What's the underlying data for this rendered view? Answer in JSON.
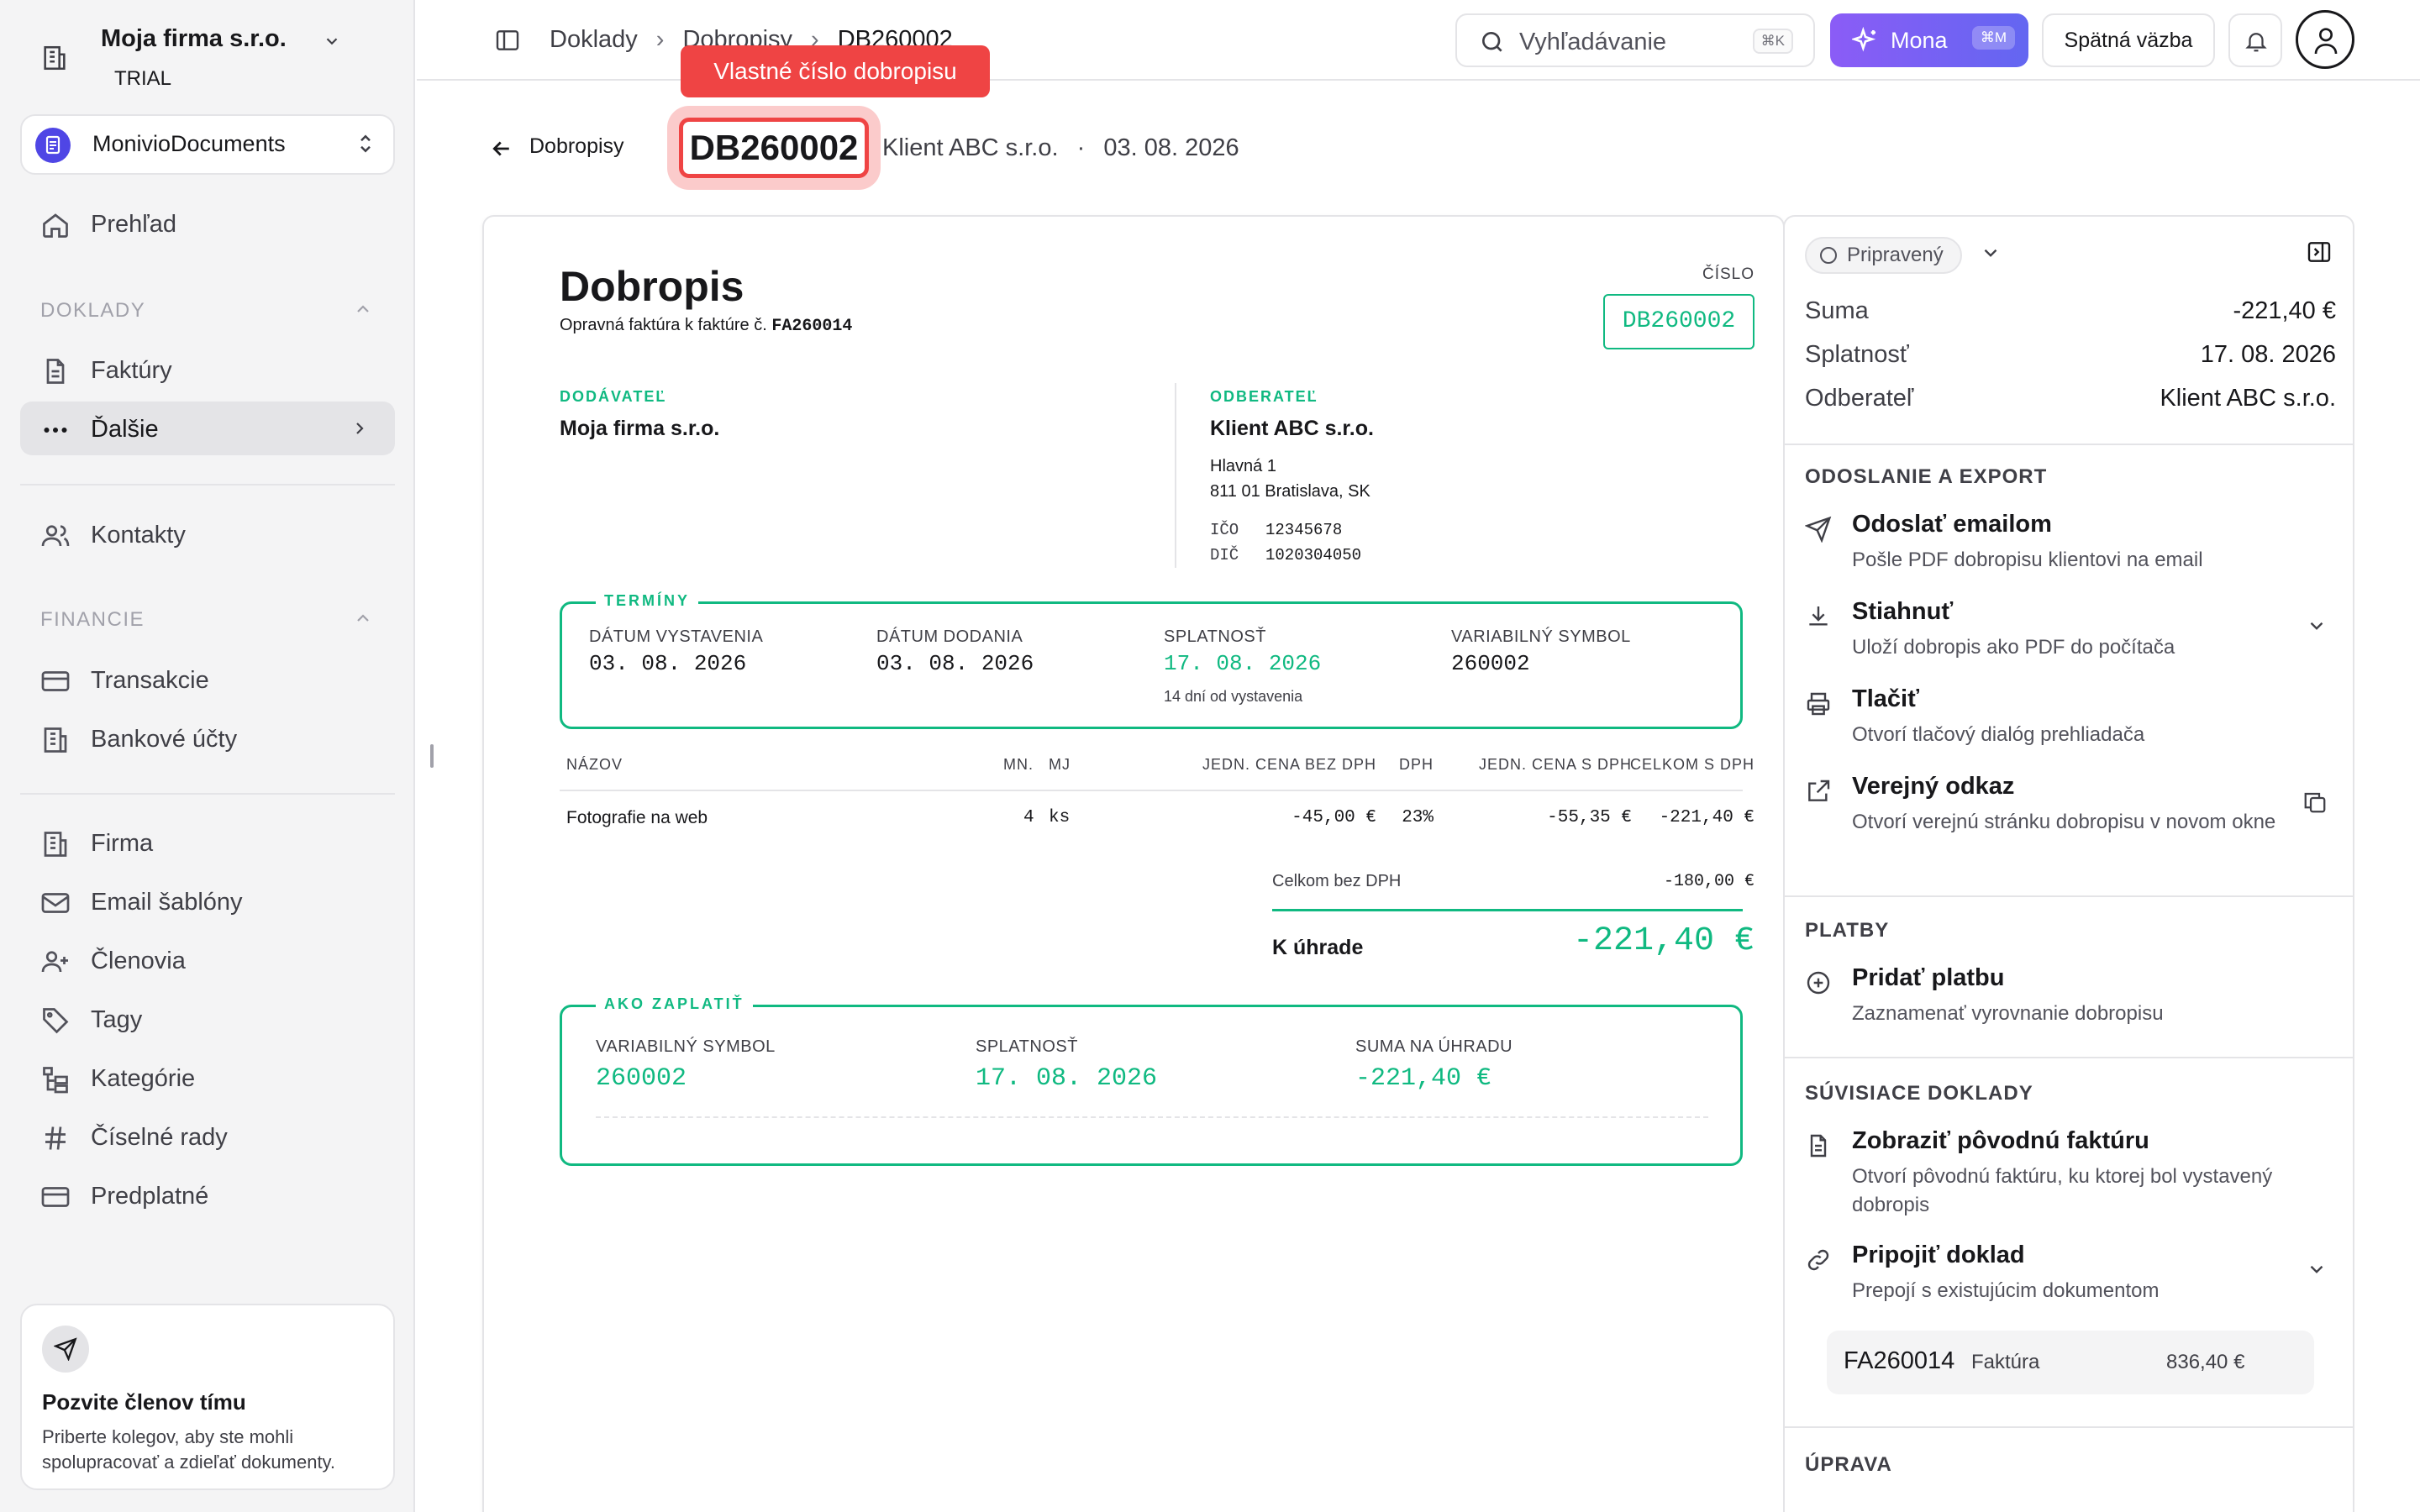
{
  "company": {
    "name": "Moja firma s.r.o.",
    "plan": "TRIAL"
  },
  "workspace": {
    "name": "MonivioDocuments"
  },
  "nav": {
    "overview": "Prehľad",
    "section_documents": "DOKLADY",
    "invoices": "Faktúry",
    "more": "Ďalšie",
    "contacts": "Kontakty",
    "section_finance": "FINANCIE",
    "transactions": "Transakcie",
    "bank_accounts": "Bankové účty",
    "firm": "Firma",
    "email_templates": "Email šablóny",
    "members": "Členovia",
    "tags": "Tagy",
    "categories": "Kategórie",
    "number_series": "Číselné rady",
    "subscription": "Predplatné"
  },
  "invite": {
    "title": "Pozvite členov tímu",
    "desc": "Priberte kolegov, aby ste mohli spolupracovať a zdieľať dokumenty."
  },
  "breadcrumb": [
    "Doklady",
    "Dobropisy",
    "DB260002"
  ],
  "search": {
    "placeholder": "Vyhľadávanie",
    "shortcut": "⌘K"
  },
  "mona": {
    "label": "Mona",
    "shortcut": "⌘M"
  },
  "feedback": "Spätná väzba",
  "header": {
    "back": "Dobropisy",
    "code": "DB260002",
    "client": "Klient ABC s.r.o.",
    "sep": "·",
    "date": "03. 08. 2026"
  },
  "tooltip": "Vlastné číslo dobropisu",
  "doc": {
    "title": "Dobropis",
    "subtitle_prefix": "Opravná faktúra k faktúre č.",
    "subtitle_ref": "FA260014",
    "number_label": "ČÍSLO",
    "number": "DB260002",
    "supplier_label": "DODÁVATEĽ",
    "supplier_name": "Moja firma s.r.o.",
    "customer_label": "ODBERATEĽ",
    "customer_name": "Klient ABC s.r.o.",
    "customer_street": "Hlavná 1",
    "customer_city": "811 01 Bratislava, SK",
    "ico_label": "IČO",
    "ico": "12345678",
    "dic_label": "DIČ",
    "dic": "1020304050",
    "terms_label": "TERMÍNY",
    "issue_label": "DÁTUM VYSTAVENIA",
    "issue": "03. 08. 2026",
    "delivery_label": "DÁTUM DODANIA",
    "delivery": "03. 08. 2026",
    "due_label": "SPLATNOSŤ",
    "due": "17. 08. 2026",
    "due_note": "14 dní od vystavenia",
    "vs_label": "VARIABILNÝ SYMBOL",
    "vs": "260002",
    "columns": [
      "NÁZOV",
      "MN.",
      "MJ",
      "JEDN. CENA BEZ DPH",
      "DPH",
      "JEDN. CENA S DPH",
      "CELKOM S DPH"
    ],
    "rows": [
      [
        "Fotografie na web",
        "4",
        "ks",
        "-45,00 €",
        "23%",
        "-55,35 €",
        "-221,40 €"
      ]
    ],
    "subtotal_label": "Celkom bez DPH",
    "subtotal": "-180,00 €",
    "total_label": "K úhrade",
    "total": "-221,40 €",
    "pay_label": "AKO ZAPLATIŤ",
    "pay_vs_label": "VARIABILNÝ SYMBOL",
    "pay_vs": "260002",
    "pay_due_label": "SPLATNOSŤ",
    "pay_due": "17. 08. 2026",
    "pay_sum_label": "SUMA NA ÚHRADU",
    "pay_sum": "-221,40 €"
  },
  "panel": {
    "status": "Pripravený",
    "sum_label": "Suma",
    "sum": "-221,40 €",
    "due_label": "Splatnosť",
    "due": "17. 08. 2026",
    "customer_label": "Odberateľ",
    "customer": "Klient ABC s.r.o.",
    "export_title": "ODOSLANIE A EXPORT",
    "email_title": "Odoslať emailom",
    "email_desc": "Pošle PDF dobropisu klientovi na email",
    "download_title": "Stiahnuť",
    "download_desc": "Uloží dobropis ako PDF do počítača",
    "print_title": "Tlačiť",
    "print_desc": "Otvorí tlačový dialóg prehliadača",
    "public_title": "Verejný odkaz",
    "public_desc": "Otvorí verejnú stránku dobropisu v novom okne",
    "payments_title": "PLATBY",
    "addpay_title": "Pridať platbu",
    "addpay_desc": "Zaznamenať vyrovnanie dobropisu",
    "related_title": "SÚVISIACE DOKLADY",
    "orig_title": "Zobraziť pôvodnú faktúru",
    "orig_desc": "Otvorí pôvodnú faktúru, ku ktorej bol vystavený dobropis",
    "attach_title": "Pripojiť doklad",
    "attach_desc": "Prepojí s existujúcim dokumentom",
    "related_code": "FA260014",
    "related_type": "Faktúra",
    "related_amount": "836,40 €",
    "edit_title": "ÚPRAVA"
  },
  "colors": {
    "accent": "#10b981",
    "highlight": "#ef4444",
    "mona": "#7c5cf6"
  }
}
